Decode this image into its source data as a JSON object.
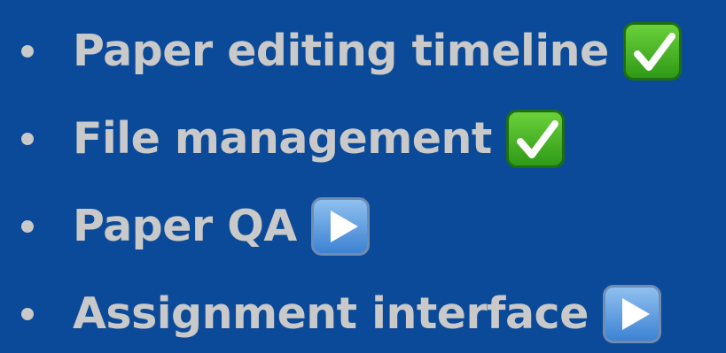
{
  "bullets": [
    {
      "text": "Paper editing timeline",
      "status_icon": "check-mark-button-icon",
      "status": "done"
    },
    {
      "text": "File management",
      "status_icon": "check-mark-button-icon",
      "status": "done"
    },
    {
      "text": "Paper QA",
      "status_icon": "play-button-icon",
      "status": "in-progress"
    },
    {
      "text": "Assignment interface",
      "status_icon": "play-button-icon",
      "status": "in-progress"
    }
  ],
  "colors": {
    "background": "#0b4a98",
    "text": "#c9c9c9",
    "done_icon": "#3fb51f",
    "progress_icon": "#5b9ae0"
  }
}
